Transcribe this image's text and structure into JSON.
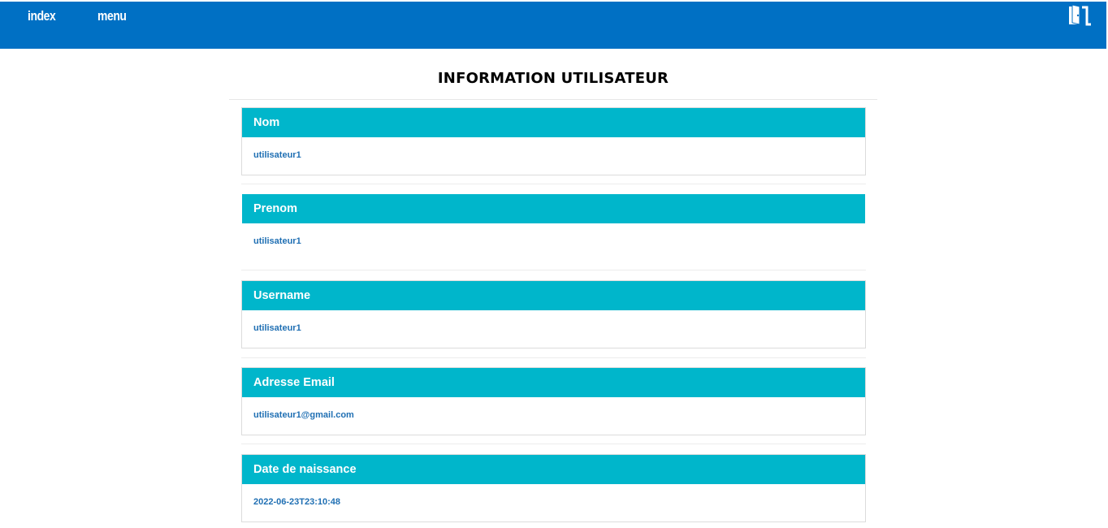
{
  "nav": {
    "index_label": "index",
    "menu_label": "menu",
    "exit_icon": "exit-door-icon"
  },
  "page": {
    "title": "INFORMATION UTILISATEUR"
  },
  "fields": [
    {
      "label": "Nom",
      "value": "utilisateur1"
    },
    {
      "label": "Prenom",
      "value": "utilisateur1"
    },
    {
      "label": "Username",
      "value": "utilisateur1"
    },
    {
      "label": "Adresse Email",
      "value": "utilisateur1@gmail.com"
    },
    {
      "label": "Date de naissance",
      "value": "2022-06-23T23:10:48"
    }
  ],
  "colors": {
    "topbar": "#0070c4",
    "card_header": "#00b6cb",
    "value_text": "#1f6fb3"
  }
}
